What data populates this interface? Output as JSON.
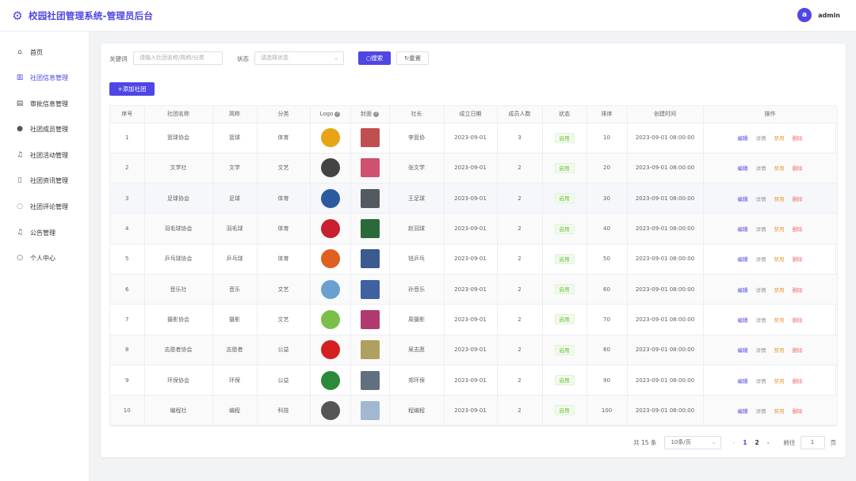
{
  "app": {
    "title": "校园社团管理系统-管理员后台",
    "logo_icon": "gear-icon",
    "accent": "#4f46e5"
  },
  "user": {
    "avatar_letter": "a",
    "name": "admin"
  },
  "sidebar": {
    "items": [
      {
        "label": "首页",
        "icon": "home-icon"
      },
      {
        "label": "社团信息管理",
        "icon": "building-icon",
        "active": true
      },
      {
        "label": "审批信息管理",
        "icon": "clipboard-icon"
      },
      {
        "label": "社团成员管理",
        "icon": "user-icon"
      },
      {
        "label": "社团活动管理",
        "icon": "bell-icon"
      },
      {
        "label": "社团资讯管理",
        "icon": "document-icon"
      },
      {
        "label": "社团评论管理",
        "icon": "chat-icon"
      },
      {
        "label": "公告管理",
        "icon": "bell-icon"
      },
      {
        "label": "个人中心",
        "icon": "person-icon"
      }
    ]
  },
  "filters": {
    "keyword_label": "关键词",
    "keyword_placeholder": "请输入社团名称/简称/分类",
    "status_label": "状态",
    "status_placeholder": "请选择状态",
    "search_label": "搜索",
    "reset_label": "重置",
    "add_label": "添加社团"
  },
  "table": {
    "columns": [
      "序号",
      "社团名称",
      "简称",
      "分类",
      "Logo",
      "封面",
      "社长",
      "成立日期",
      "成员人数",
      "状态",
      "排序",
      "创建时间",
      "操作"
    ],
    "actions": {
      "edit": "编辑",
      "detail": "详情",
      "disable": "禁用",
      "delete": "删除"
    },
    "rows": [
      {
        "no": "1",
        "name": "篮球协会",
        "short": "篮球",
        "cat": "体育",
        "leader": "李篮协",
        "date": "2023-09-01",
        "members": "3",
        "status": "启用",
        "sort": "10",
        "created": "2023-09-01 08:00:00"
      },
      {
        "no": "2",
        "name": "文学社",
        "short": "文学",
        "cat": "文艺",
        "leader": "张文学",
        "date": "2023-09-01",
        "members": "2",
        "status": "启用",
        "sort": "20",
        "created": "2023-09-01 08:00:00"
      },
      {
        "no": "3",
        "name": "足球协会",
        "short": "足球",
        "cat": "体育",
        "leader": "王足球",
        "date": "2023-09-01",
        "members": "2",
        "status": "启用",
        "sort": "30",
        "created": "2023-09-01 08:00:00"
      },
      {
        "no": "4",
        "name": "羽毛球协会",
        "short": "羽毛球",
        "cat": "体育",
        "leader": "赵羽球",
        "date": "2023-09-01",
        "members": "2",
        "status": "启用",
        "sort": "40",
        "created": "2023-09-01 08:00:00"
      },
      {
        "no": "5",
        "name": "乒乓球协会",
        "short": "乒乓球",
        "cat": "体育",
        "leader": "钱乒乓",
        "date": "2023-09-01",
        "members": "2",
        "status": "启用",
        "sort": "50",
        "created": "2023-09-01 08:00:00"
      },
      {
        "no": "6",
        "name": "音乐社",
        "short": "音乐",
        "cat": "文艺",
        "leader": "孙音乐",
        "date": "2023-09-01",
        "members": "2",
        "status": "启用",
        "sort": "60",
        "created": "2023-09-01 08:00:00"
      },
      {
        "no": "7",
        "name": "摄影协会",
        "short": "摄影",
        "cat": "文艺",
        "leader": "周摄影",
        "date": "2023-09-01",
        "members": "2",
        "status": "启用",
        "sort": "70",
        "created": "2023-09-01 08:00:00"
      },
      {
        "no": "8",
        "name": "志愿者协会",
        "short": "志愿者",
        "cat": "公益",
        "leader": "吴志愿",
        "date": "2023-09-01",
        "members": "2",
        "status": "启用",
        "sort": "80",
        "created": "2023-09-01 08:00:00"
      },
      {
        "no": "9",
        "name": "环保协会",
        "short": "环保",
        "cat": "公益",
        "leader": "郑环保",
        "date": "2023-09-01",
        "members": "2",
        "status": "启用",
        "sort": "90",
        "created": "2023-09-01 08:00:00"
      },
      {
        "no": "10",
        "name": "编程社",
        "short": "编程",
        "cat": "科技",
        "leader": "程编程",
        "date": "2023-09-01",
        "members": "2",
        "status": "启用",
        "sort": "100",
        "created": "2023-09-01 08:00:00"
      }
    ]
  },
  "pagination": {
    "total": "共 15 条",
    "page_size": "10条/页",
    "pages": [
      "1",
      "2"
    ],
    "current": "1",
    "goto_label": "前往",
    "goto_value": "1",
    "goto_unit": "页"
  }
}
